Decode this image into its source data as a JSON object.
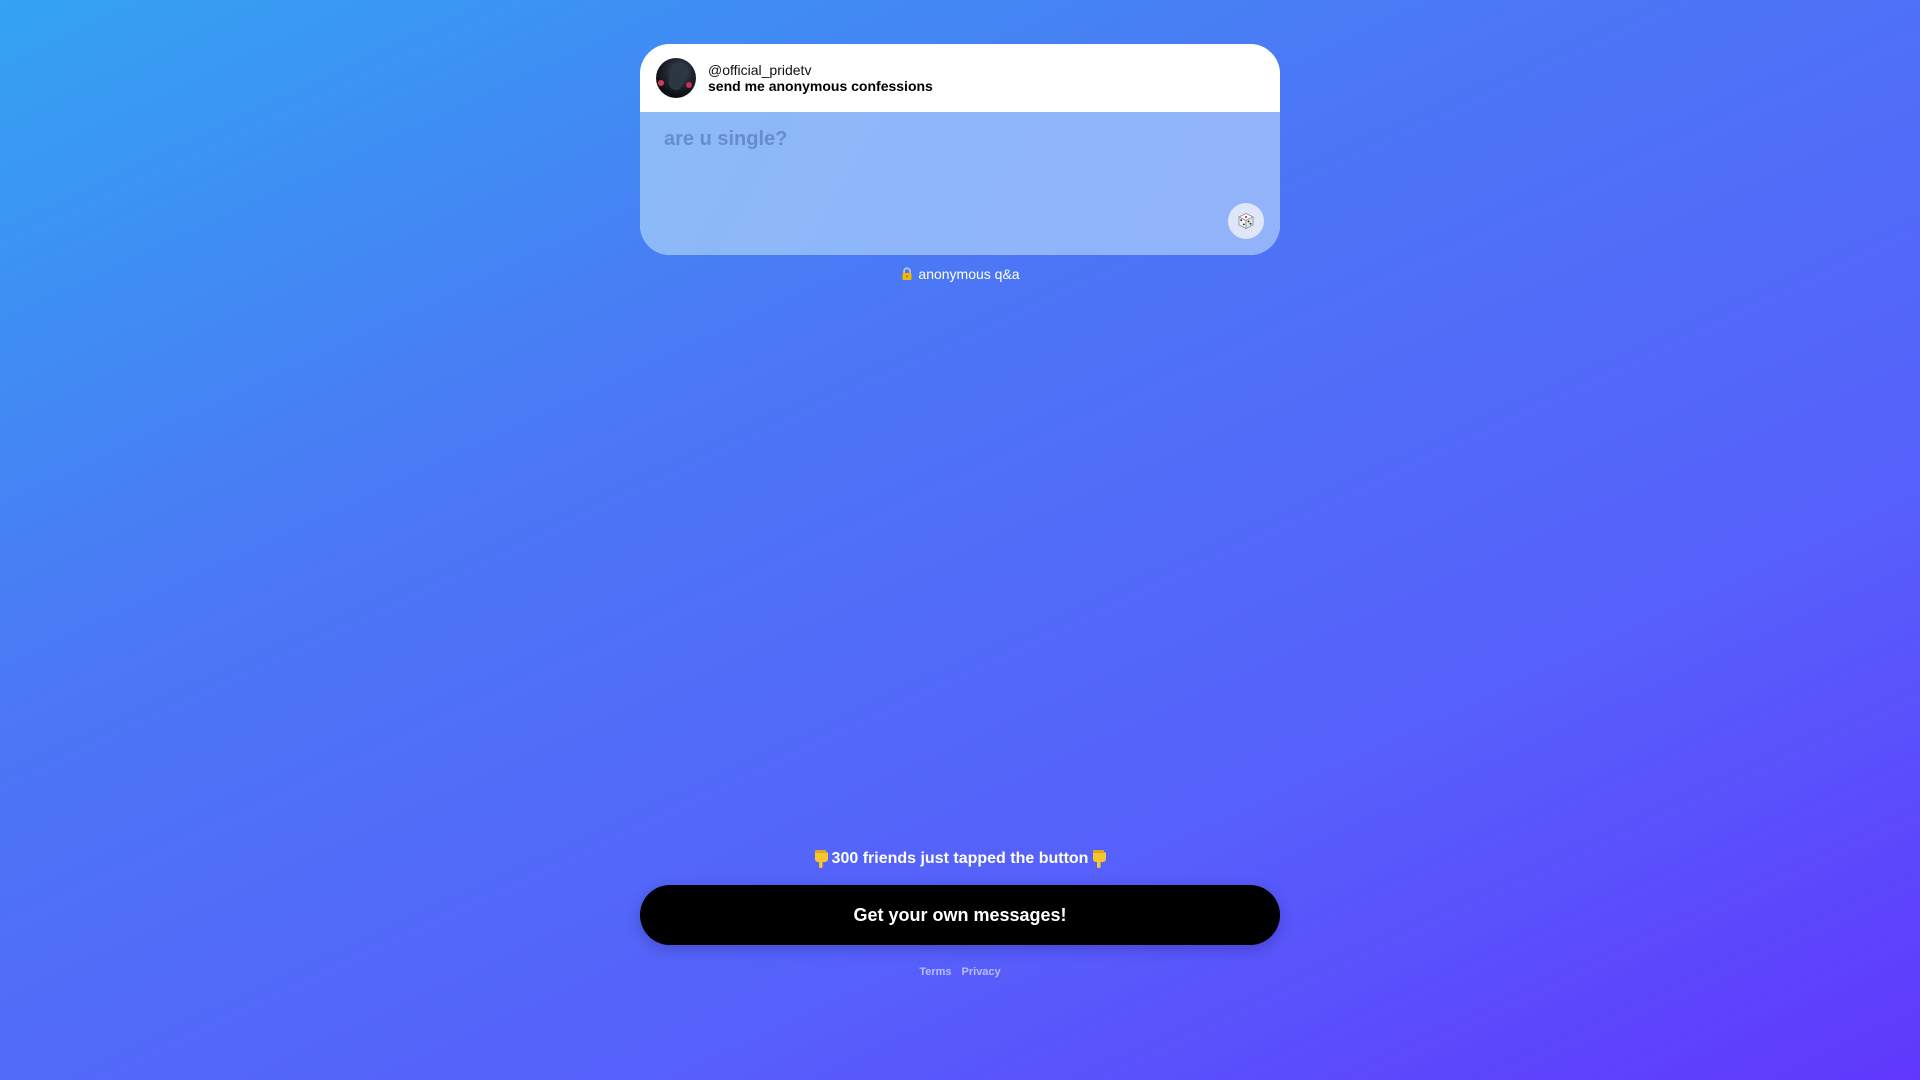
{
  "profile": {
    "username": "@official_pridetv",
    "prompt": "send me anonymous confessions"
  },
  "question": {
    "value": "",
    "placeholder": "are u single?"
  },
  "anonymous_label": "anonymous q&a",
  "cta": {
    "hint": "300 friends just tapped the button",
    "button_label": "Get your own messages!"
  },
  "footer": {
    "terms": "Terms",
    "privacy": "Privacy"
  },
  "icons": {
    "random": "dice-icon",
    "lock": "lock-icon",
    "hint_left": "pointing-down-hand-icon",
    "hint_right": "pointing-down-hand-icon"
  },
  "colors": {
    "cta_background": "#000000",
    "card_background": "#ffffff",
    "input_background": "#8fb6f9"
  }
}
